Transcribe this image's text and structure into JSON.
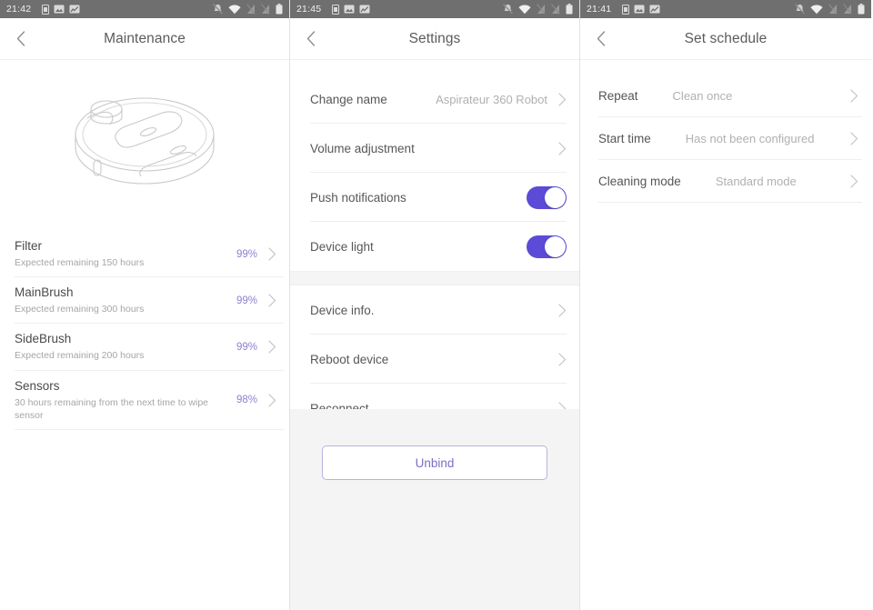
{
  "colors": {
    "accent_toggle": "#5b4bd6",
    "accent_text": "#8c82cf",
    "statusbar_bg": "#6f6f6f",
    "divider": "#eeeeee",
    "gray_fill": "#f4f4f4"
  },
  "panels": [
    {
      "id": "maintenance",
      "statusbar": {
        "time": "21:42",
        "left_icons": [
          "sim-card-icon",
          "screenshot-icon",
          "chart-icon"
        ],
        "right_icons": [
          "bell-muted-icon",
          "wifi-icon",
          "signal-disabled-icon",
          "signal-disabled-icon",
          "battery-icon"
        ]
      },
      "header": {
        "title": "Maintenance",
        "back_icon": "chevron-left-icon"
      },
      "hero": {
        "illustration": "robot-vacuum-line-drawing"
      },
      "items": [
        {
          "title": "Filter",
          "subtitle": "Expected remaining 150 hours",
          "percent": "99%",
          "chevron": "chevron-right-icon"
        },
        {
          "title": "MainBrush",
          "subtitle": "Expected remaining 300 hours",
          "percent": "99%",
          "chevron": "chevron-right-icon"
        },
        {
          "title": "SideBrush",
          "subtitle": "Expected remaining 200 hours",
          "percent": "99%",
          "chevron": "chevron-right-icon"
        },
        {
          "title": "Sensors",
          "subtitle": "30 hours remaining from the next time to wipe sensor",
          "percent": "98%",
          "chevron": "chevron-right-icon"
        }
      ]
    },
    {
      "id": "settings",
      "statusbar": {
        "time": "21:45",
        "left_icons": [
          "sim-card-icon",
          "screenshot-icon",
          "chart-icon"
        ],
        "right_icons": [
          "bell-muted-icon",
          "wifi-icon",
          "signal-disabled-icon",
          "signal-disabled-icon",
          "battery-icon"
        ]
      },
      "header": {
        "title": "Settings",
        "back_icon": "chevron-left-icon"
      },
      "rows_top": [
        {
          "label": "Change name",
          "value": "Aspirateur 360 Robot",
          "type": "value",
          "chevron": "chevron-right-icon"
        },
        {
          "label": "Volume adjustment",
          "value": "",
          "type": "value",
          "chevron": "chevron-right-icon"
        },
        {
          "label": "Push notifications",
          "value": "",
          "type": "toggle",
          "toggle_on": true
        },
        {
          "label": "Device light",
          "value": "",
          "type": "toggle",
          "toggle_on": true
        }
      ],
      "rows_bottom": [
        {
          "label": "Device info.",
          "value": "",
          "type": "value",
          "chevron": "chevron-right-icon"
        },
        {
          "label": "Reboot device",
          "value": "",
          "type": "value",
          "chevron": "chevron-right-icon"
        },
        {
          "label": "Reconnect",
          "value": "",
          "type": "value",
          "chevron": "chevron-right-icon"
        }
      ],
      "unbind_label": "Unbind"
    },
    {
      "id": "schedule",
      "statusbar": {
        "time": "21:41",
        "left_icons": [
          "sim-card-icon",
          "screenshot-icon",
          "chart-icon"
        ],
        "right_icons": [
          "bell-muted-icon",
          "wifi-icon",
          "signal-disabled-icon",
          "signal-disabled-icon",
          "battery-icon"
        ]
      },
      "header": {
        "title": "Set schedule",
        "back_icon": "chevron-left-icon"
      },
      "rows": [
        {
          "label": "Repeat",
          "value": "Clean once",
          "chevron": "chevron-right-icon"
        },
        {
          "label": "Start time",
          "value": "Has not been configured",
          "chevron": "chevron-right-icon"
        },
        {
          "label": "Cleaning mode",
          "value": "Standard mode",
          "chevron": "chevron-right-icon"
        }
      ]
    }
  ]
}
